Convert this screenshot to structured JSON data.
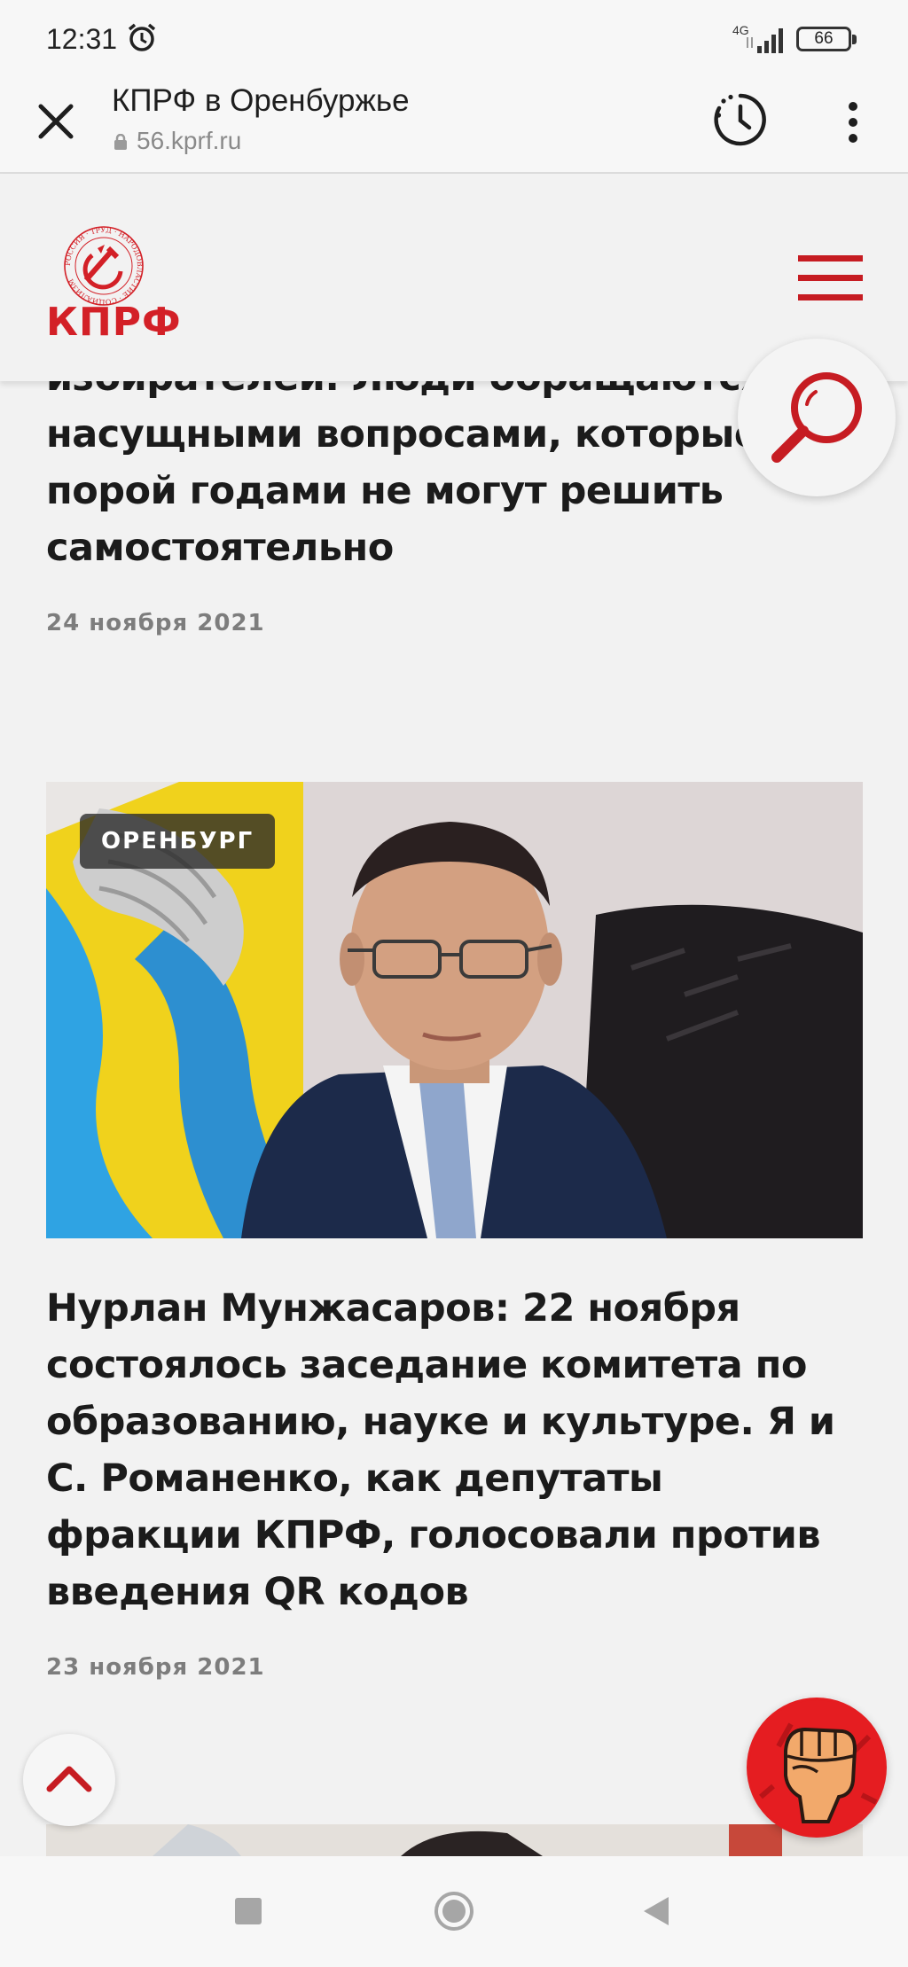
{
  "status_bar": {
    "time": "12:31",
    "network": "4G",
    "battery": "66"
  },
  "browser": {
    "title": "КПРФ в Оренбуржье",
    "url": "56.kprf.ru"
  },
  "site": {
    "logo_text": "КПРФ",
    "emblem_ring_text": "РОССИЯ · ТРУД · НАРОДОВЛАСТИЕ · СОЦИАЛИЗМ"
  },
  "articles": [
    {
      "title": "избирателей. Люди обращаются с насущными вопросами, которые порой годами не могут решить самостоятельно",
      "date": "24 ноября 2021"
    },
    {
      "tag": "ОРЕНБУРГ",
      "title": "Нурлан Мунжасаров: 22 ноября состоялось заседание комитета по образованию, науке и культуре. Я и С. Романенко, как депутаты фракции КПРФ, голосовали против введения QR кодов",
      "date": "23 ноября 2021"
    }
  ],
  "colors": {
    "brand_red": "#d32027",
    "background": "#f2f2f2"
  },
  "icons": {
    "close": "close-icon",
    "history": "history-icon",
    "more": "more-vert-icon",
    "menu": "hamburger-icon",
    "search": "search-icon",
    "scroll_top": "chevron-up-icon",
    "fist": "fist-icon"
  }
}
